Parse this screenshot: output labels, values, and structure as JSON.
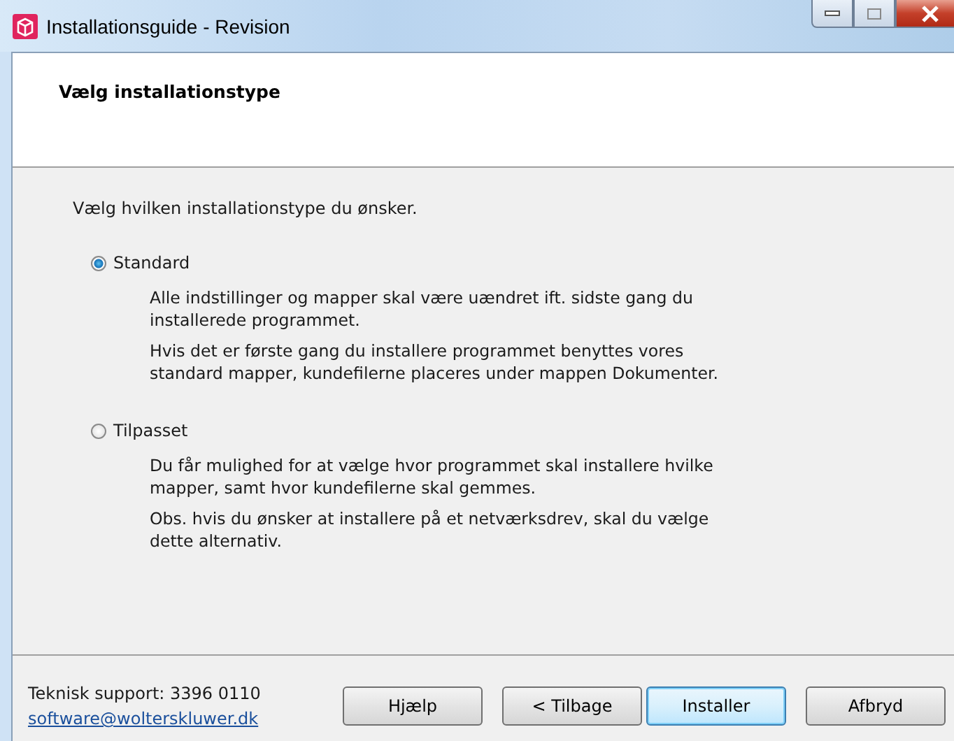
{
  "window": {
    "title": "Installationsguide - Revision"
  },
  "header": {
    "title": "Vælg installationstype"
  },
  "intro": "Vælg hvilken installationstype du ønsker.",
  "options": [
    {
      "label": "Standard",
      "selected": true,
      "paragraphs": [
        "Alle indstillinger og mapper skal være uændret ift. sidste gang du\ninstallerede programmet.",
        "Hvis det er første gang du installere programmet benyttes vores\nstandard mapper, kundefilerne placeres under mappen Dokumenter."
      ]
    },
    {
      "label": "Tilpasset",
      "selected": false,
      "paragraphs": [
        "Du får mulighed for at vælge hvor programmet skal installere hvilke\nmapper, samt hvor kundefilerne skal gemmes.",
        "Obs. hvis du ønsker at installere på et netværksdrev, skal du vælge\ndette alternativ."
      ]
    }
  ],
  "footer": {
    "support": "Teknisk support: 3396 0110",
    "email": "software@wolterskluwer.dk"
  },
  "buttons": [
    {
      "label": "Hjælp",
      "default": false
    },
    {
      "label": "< Tilbage",
      "default": false
    },
    {
      "label": "Installer",
      "default": true
    },
    {
      "label": "Afbryd",
      "default": false
    }
  ]
}
